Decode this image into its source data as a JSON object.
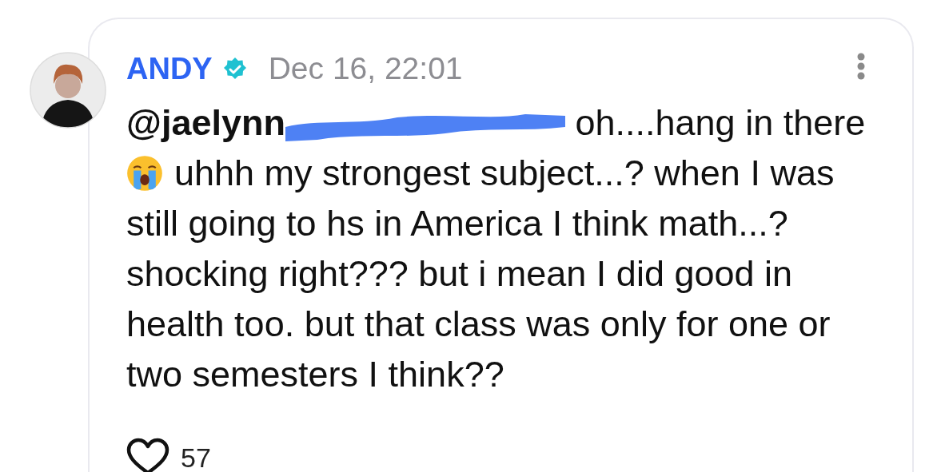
{
  "comment": {
    "author": "ANDY",
    "verified": true,
    "date": "Dec 16, 22:01",
    "mention": "@jaelynn",
    "redacted": true,
    "text_start": "oh....hang in there",
    "text_line": "uhhh my strongest subject...? when I was",
    "text": "still going to hs in America I think math...? shocking right??? but i mean I did good in health too. but that class was only for one or two semesters I think??",
    "likes": "57",
    "liked": false
  }
}
